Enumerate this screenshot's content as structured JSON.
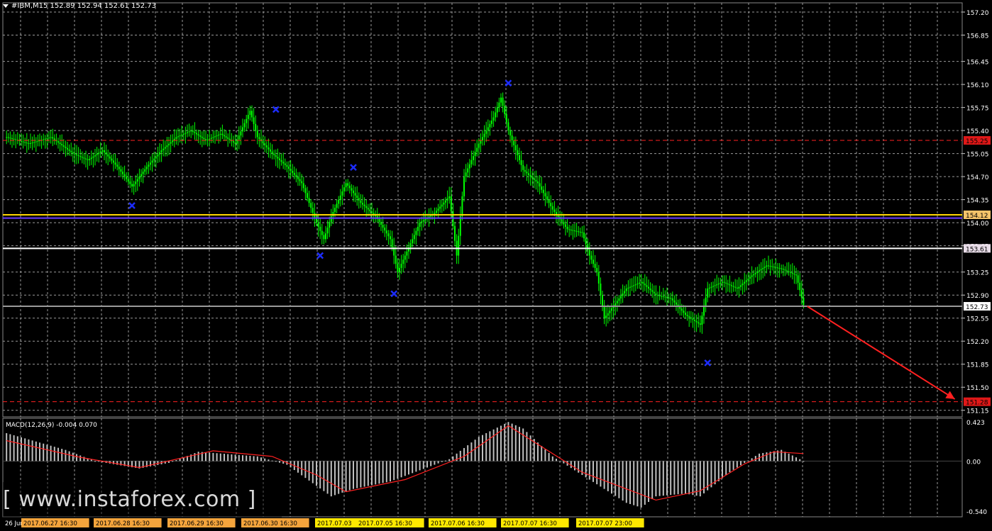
{
  "header": {
    "title": "#IBM,M15  152.89 152.94 152.61 152.73"
  },
  "macd_label": "MACD(12,26,9) -0.004 0.070",
  "watermark": "[ www.instaforex.com ]",
  "colors": {
    "background": "#000000",
    "candles": "#00ff00",
    "grid": "#9a9a9a",
    "support_resistance": "#ff2020",
    "level_yellow": "#ffd700",
    "level_purple": "#6a3cff",
    "marker": "#1c2cff",
    "histogram": "#c0c0c0",
    "signal": "#ff2020",
    "arrow": "#ff2020"
  },
  "chart_data": [
    {
      "type": "candlestick",
      "symbol": "#IBM",
      "timeframe": "M15",
      "ohlc_last": {
        "open": 152.89,
        "high": 152.94,
        "low": 152.61,
        "close": 152.73
      },
      "ylim": [
        151.05,
        157.34
      ],
      "y_ticks": [
        "157.20",
        "156.85",
        "156.45",
        "156.10",
        "155.75",
        "155.40",
        "155.05",
        "154.70",
        "154.35",
        "154.00",
        "153.65",
        "153.25",
        "152.90",
        "152.55",
        "152.20",
        "151.85",
        "151.50",
        "151.15"
      ],
      "x_tick_labels": [
        {
          "text": "26 Jun 2017",
          "highlight": false
        },
        {
          "text": "2017.06.27 16:30",
          "highlight": "orange"
        },
        {
          "text": "2017.06.28 16:30",
          "highlight": "orange"
        },
        {
          "text": "2017.06.29 16:30",
          "highlight": "orange"
        },
        {
          "text": "2017.06.30 16:30",
          "highlight": "orange"
        },
        {
          "text": "2017.07.03",
          "highlight": "yellow"
        },
        {
          "text": "2017.07.05 16:30",
          "highlight": "yellow"
        },
        {
          "text": "2017.07.06 16:30",
          "highlight": "yellow"
        },
        {
          "text": "2017.07.07 16:30",
          "highlight": "yellow"
        },
        {
          "text": "2017.07.07 23:00",
          "highlight": "yellow"
        }
      ],
      "price_points": [
        [
          0,
          155.3
        ],
        [
          3,
          155.2
        ],
        [
          6,
          155.3
        ],
        [
          9,
          155.05
        ],
        [
          11,
          154.95
        ],
        [
          13,
          155.1
        ],
        [
          15,
          154.85
        ],
        [
          17,
          154.55
        ],
        [
          19,
          154.85
        ],
        [
          21,
          155.1
        ],
        [
          23,
          155.3
        ],
        [
          25,
          155.4
        ],
        [
          27,
          155.25
        ],
        [
          29,
          155.35
        ],
        [
          31,
          155.2
        ],
        [
          33,
          155.7
        ],
        [
          34,
          155.3
        ],
        [
          36,
          155.05
        ],
        [
          38,
          154.85
        ],
        [
          40,
          154.6
        ],
        [
          42,
          154.0
        ],
        [
          43,
          153.75
        ],
        [
          44,
          154.1
        ],
        [
          46,
          154.6
        ],
        [
          48,
          154.3
        ],
        [
          50,
          154.1
        ],
        [
          52,
          153.75
        ],
        [
          53,
          153.25
        ],
        [
          54,
          153.5
        ],
        [
          56,
          154.0
        ],
        [
          58,
          154.15
        ],
        [
          60,
          154.4
        ],
        [
          61,
          153.5
        ],
        [
          62,
          154.7
        ],
        [
          64,
          155.2
        ],
        [
          66,
          155.6
        ],
        [
          67,
          155.9
        ],
        [
          68,
          155.4
        ],
        [
          70,
          154.8
        ],
        [
          72,
          154.6
        ],
        [
          74,
          154.2
        ],
        [
          76,
          153.9
        ],
        [
          78,
          153.85
        ],
        [
          79,
          153.5
        ],
        [
          80,
          153.25
        ],
        [
          81,
          152.55
        ],
        [
          82,
          152.7
        ],
        [
          84,
          153.0
        ],
        [
          86,
          153.1
        ],
        [
          88,
          152.9
        ],
        [
          90,
          152.85
        ],
        [
          92,
          152.6
        ],
        [
          94,
          152.45
        ],
        [
          95,
          153.0
        ],
        [
          97,
          153.1
        ],
        [
          99,
          153.0
        ],
        [
          101,
          153.2
        ],
        [
          103,
          153.35
        ],
        [
          105,
          153.3
        ],
        [
          107,
          153.2
        ],
        [
          108,
          152.75
        ]
      ],
      "levels": [
        {
          "price": 155.25,
          "style": "dashed",
          "color": "#ff2020",
          "label": "155.25"
        },
        {
          "price": 154.12,
          "style": "solid",
          "color": "#ffd700",
          "label": "154.12"
        },
        {
          "price": 154.07,
          "style": "solid",
          "color": "#6a3cff",
          "label": ""
        },
        {
          "price": 153.61,
          "style": "solid",
          "color": "#ffffff",
          "label": "153.61"
        },
        {
          "price": 152.73,
          "style": "solid",
          "color": "#9a9a9a",
          "label": "152.73"
        },
        {
          "price": 151.28,
          "style": "dashed",
          "color": "#ff2020",
          "label": "151.28"
        }
      ],
      "markers": [
        {
          "x": 17,
          "price": 154.26
        },
        {
          "x": 36.5,
          "price": 155.72
        },
        {
          "x": 42.5,
          "price": 153.5
        },
        {
          "x": 47,
          "price": 154.84
        },
        {
          "x": 52.5,
          "price": 152.92
        },
        {
          "x": 68,
          "price": 156.12
        },
        {
          "x": 95,
          "price": 151.87
        }
      ],
      "forecast_arrow": {
        "from": [
          108.5,
          152.73
        ],
        "to": [
          128.5,
          151.32
        ]
      }
    },
    {
      "type": "bar",
      "indicator": "MACD(12,26,9)",
      "main": -0.004,
      "signal_value": 0.07,
      "ylim": [
        -0.6,
        0.46
      ],
      "y_ticks": [
        "0.423",
        "0.00",
        "-0.540"
      ],
      "histogram_points": [
        [
          0,
          0.3
        ],
        [
          8,
          0.12
        ],
        [
          12,
          0.0
        ],
        [
          18,
          -0.08
        ],
        [
          22,
          -0.02
        ],
        [
          26,
          0.1
        ],
        [
          34,
          0.05
        ],
        [
          38,
          -0.04
        ],
        [
          44,
          -0.38
        ],
        [
          47,
          -0.3
        ],
        [
          52,
          -0.22
        ],
        [
          56,
          -0.1
        ],
        [
          60,
          0.02
        ],
        [
          64,
          0.26
        ],
        [
          68,
          0.42
        ],
        [
          70,
          0.35
        ],
        [
          74,
          0.05
        ],
        [
          78,
          -0.15
        ],
        [
          84,
          -0.45
        ],
        [
          86,
          -0.5
        ],
        [
          88,
          -0.38
        ],
        [
          92,
          -0.35
        ],
        [
          94,
          -0.38
        ],
        [
          98,
          -0.12
        ],
        [
          102,
          0.08
        ],
        [
          105,
          0.12
        ],
        [
          108,
          0.0
        ]
      ],
      "signal_points": [
        [
          0,
          0.22
        ],
        [
          10,
          0.04
        ],
        [
          18,
          -0.07
        ],
        [
          28,
          0.11
        ],
        [
          36,
          0.05
        ],
        [
          42,
          -0.15
        ],
        [
          46,
          -0.33
        ],
        [
          54,
          -0.2
        ],
        [
          62,
          0.05
        ],
        [
          68,
          0.38
        ],
        [
          72,
          0.18
        ],
        [
          78,
          -0.12
        ],
        [
          84,
          -0.3
        ],
        [
          88,
          -0.42
        ],
        [
          94,
          -0.32
        ],
        [
          100,
          -0.03
        ],
        [
          104,
          0.1
        ],
        [
          108,
          0.08
        ]
      ]
    }
  ]
}
